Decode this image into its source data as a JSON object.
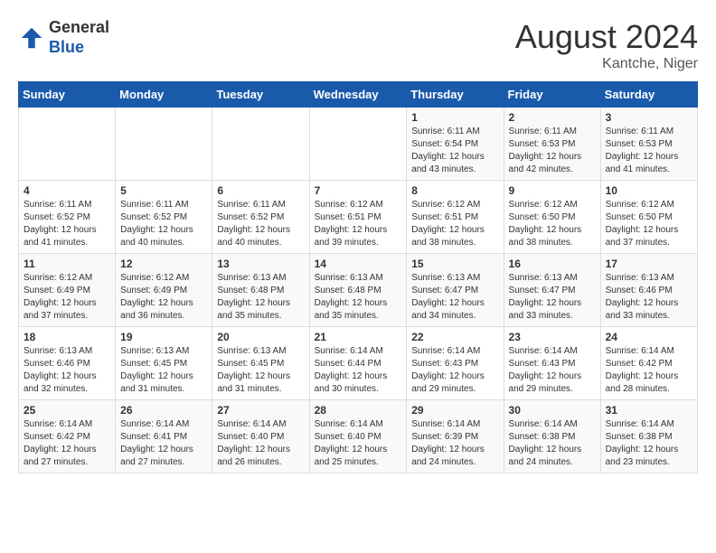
{
  "header": {
    "logo_general": "General",
    "logo_blue": "Blue",
    "month_year": "August 2024",
    "location": "Kantche, Niger"
  },
  "weekdays": [
    "Sunday",
    "Monday",
    "Tuesday",
    "Wednesday",
    "Thursday",
    "Friday",
    "Saturday"
  ],
  "weeks": [
    [
      {
        "day": "",
        "info": ""
      },
      {
        "day": "",
        "info": ""
      },
      {
        "day": "",
        "info": ""
      },
      {
        "day": "",
        "info": ""
      },
      {
        "day": "1",
        "info": "Sunrise: 6:11 AM\nSunset: 6:54 PM\nDaylight: 12 hours\nand 43 minutes."
      },
      {
        "day": "2",
        "info": "Sunrise: 6:11 AM\nSunset: 6:53 PM\nDaylight: 12 hours\nand 42 minutes."
      },
      {
        "day": "3",
        "info": "Sunrise: 6:11 AM\nSunset: 6:53 PM\nDaylight: 12 hours\nand 41 minutes."
      }
    ],
    [
      {
        "day": "4",
        "info": "Sunrise: 6:11 AM\nSunset: 6:52 PM\nDaylight: 12 hours\nand 41 minutes."
      },
      {
        "day": "5",
        "info": "Sunrise: 6:11 AM\nSunset: 6:52 PM\nDaylight: 12 hours\nand 40 minutes."
      },
      {
        "day": "6",
        "info": "Sunrise: 6:11 AM\nSunset: 6:52 PM\nDaylight: 12 hours\nand 40 minutes."
      },
      {
        "day": "7",
        "info": "Sunrise: 6:12 AM\nSunset: 6:51 PM\nDaylight: 12 hours\nand 39 minutes."
      },
      {
        "day": "8",
        "info": "Sunrise: 6:12 AM\nSunset: 6:51 PM\nDaylight: 12 hours\nand 38 minutes."
      },
      {
        "day": "9",
        "info": "Sunrise: 6:12 AM\nSunset: 6:50 PM\nDaylight: 12 hours\nand 38 minutes."
      },
      {
        "day": "10",
        "info": "Sunrise: 6:12 AM\nSunset: 6:50 PM\nDaylight: 12 hours\nand 37 minutes."
      }
    ],
    [
      {
        "day": "11",
        "info": "Sunrise: 6:12 AM\nSunset: 6:49 PM\nDaylight: 12 hours\nand 37 minutes."
      },
      {
        "day": "12",
        "info": "Sunrise: 6:12 AM\nSunset: 6:49 PM\nDaylight: 12 hours\nand 36 minutes."
      },
      {
        "day": "13",
        "info": "Sunrise: 6:13 AM\nSunset: 6:48 PM\nDaylight: 12 hours\nand 35 minutes."
      },
      {
        "day": "14",
        "info": "Sunrise: 6:13 AM\nSunset: 6:48 PM\nDaylight: 12 hours\nand 35 minutes."
      },
      {
        "day": "15",
        "info": "Sunrise: 6:13 AM\nSunset: 6:47 PM\nDaylight: 12 hours\nand 34 minutes."
      },
      {
        "day": "16",
        "info": "Sunrise: 6:13 AM\nSunset: 6:47 PM\nDaylight: 12 hours\nand 33 minutes."
      },
      {
        "day": "17",
        "info": "Sunrise: 6:13 AM\nSunset: 6:46 PM\nDaylight: 12 hours\nand 33 minutes."
      }
    ],
    [
      {
        "day": "18",
        "info": "Sunrise: 6:13 AM\nSunset: 6:46 PM\nDaylight: 12 hours\nand 32 minutes."
      },
      {
        "day": "19",
        "info": "Sunrise: 6:13 AM\nSunset: 6:45 PM\nDaylight: 12 hours\nand 31 minutes."
      },
      {
        "day": "20",
        "info": "Sunrise: 6:13 AM\nSunset: 6:45 PM\nDaylight: 12 hours\nand 31 minutes."
      },
      {
        "day": "21",
        "info": "Sunrise: 6:14 AM\nSunset: 6:44 PM\nDaylight: 12 hours\nand 30 minutes."
      },
      {
        "day": "22",
        "info": "Sunrise: 6:14 AM\nSunset: 6:43 PM\nDaylight: 12 hours\nand 29 minutes."
      },
      {
        "day": "23",
        "info": "Sunrise: 6:14 AM\nSunset: 6:43 PM\nDaylight: 12 hours\nand 29 minutes."
      },
      {
        "day": "24",
        "info": "Sunrise: 6:14 AM\nSunset: 6:42 PM\nDaylight: 12 hours\nand 28 minutes."
      }
    ],
    [
      {
        "day": "25",
        "info": "Sunrise: 6:14 AM\nSunset: 6:42 PM\nDaylight: 12 hours\nand 27 minutes."
      },
      {
        "day": "26",
        "info": "Sunrise: 6:14 AM\nSunset: 6:41 PM\nDaylight: 12 hours\nand 27 minutes."
      },
      {
        "day": "27",
        "info": "Sunrise: 6:14 AM\nSunset: 6:40 PM\nDaylight: 12 hours\nand 26 minutes."
      },
      {
        "day": "28",
        "info": "Sunrise: 6:14 AM\nSunset: 6:40 PM\nDaylight: 12 hours\nand 25 minutes."
      },
      {
        "day": "29",
        "info": "Sunrise: 6:14 AM\nSunset: 6:39 PM\nDaylight: 12 hours\nand 24 minutes."
      },
      {
        "day": "30",
        "info": "Sunrise: 6:14 AM\nSunset: 6:38 PM\nDaylight: 12 hours\nand 24 minutes."
      },
      {
        "day": "31",
        "info": "Sunrise: 6:14 AM\nSunset: 6:38 PM\nDaylight: 12 hours\nand 23 minutes."
      }
    ]
  ]
}
